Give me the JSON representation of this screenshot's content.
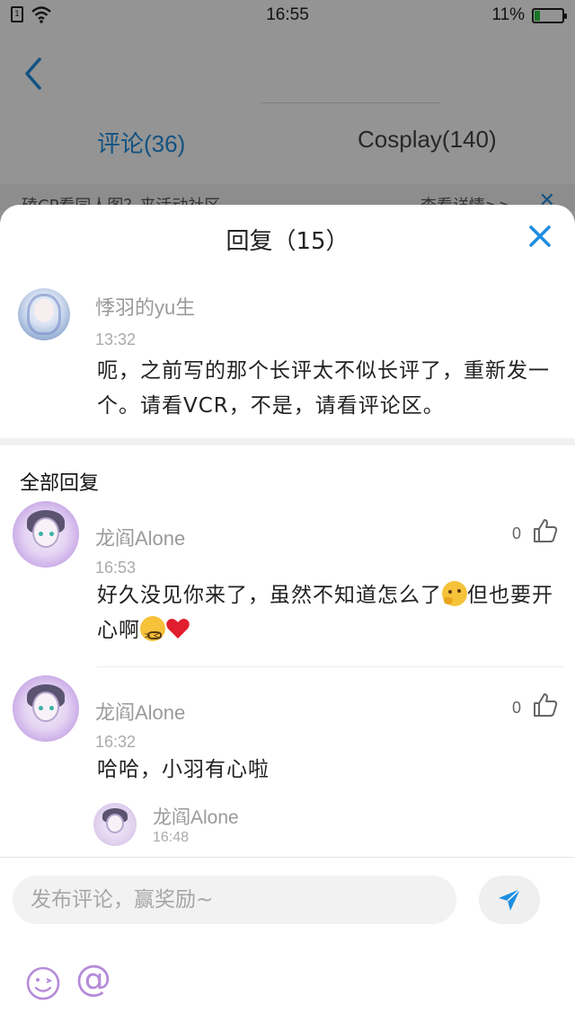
{
  "status_bar": {
    "time": "16:55",
    "battery": "11%"
  },
  "background": {
    "tabs": [
      {
        "label": "评论(36)"
      },
      {
        "label": "Cosplay(140)"
      }
    ],
    "notice": {
      "text": "磕CP看同人图？来活动社区",
      "link": "查看详情>>"
    }
  },
  "sheet": {
    "title": "回复（15）",
    "main_comment": {
      "author": "悸羽的yu生",
      "time": "13:32",
      "text": "呃，之前写的那个长评太不似长评了，重新发一个。请看VCR，不是，请看评论区。"
    },
    "section_title": "全部回复",
    "replies": [
      {
        "author": "龙阎Alone",
        "time": "16:53",
        "likes": "0",
        "text_part1": "好久没见你来了，虽然不知道怎么了",
        "text_part2": "但也要开心啊"
      },
      {
        "author": "龙阎Alone",
        "time": "16:32",
        "likes": "0",
        "text": "哈哈，小羽有心啦",
        "sub_reply": {
          "author": "龙阎Alone",
          "time": "16:48"
        }
      }
    ]
  },
  "footer": {
    "input_placeholder": "发布评论，赢奖励~"
  },
  "colors": {
    "accent": "#1f8ee0",
    "at_color": "#b58bd9"
  }
}
